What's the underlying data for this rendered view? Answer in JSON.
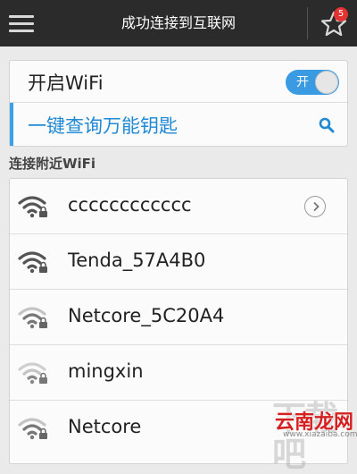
{
  "header": {
    "title": "成功连接到互联网",
    "menu_icon": "menu-icon",
    "favorites_icon": "star-icon",
    "favorites_badge": "5"
  },
  "wifi_toggle": {
    "label": "开启WiFi",
    "state_text": "开",
    "on": true
  },
  "query": {
    "label": "一键查询万能钥匙",
    "icon": "search-icon"
  },
  "nearby": {
    "section_title": "连接附近WiFi",
    "networks": [
      {
        "name": "cccccccccccc",
        "signal": "strong",
        "locked": true,
        "has_detail": true
      },
      {
        "name": "Tenda_57A4B0",
        "signal": "strong",
        "locked": true,
        "has_detail": false
      },
      {
        "name": "Netcore_5C20A4",
        "signal": "medium",
        "locked": true,
        "has_detail": false
      },
      {
        "name": "mingxin",
        "signal": "weak",
        "locked": true,
        "has_detail": false
      },
      {
        "name": "Netcore",
        "signal": "medium",
        "locked": true,
        "has_detail": false
      }
    ]
  },
  "watermark": {
    "text": "云南龙网",
    "background_text": "下载吧",
    "url": "www.xiazaiba.com"
  },
  "colors": {
    "header_bg": "#2b2b2b",
    "accent_blue": "#3b9be2",
    "badge_red": "#e23232"
  }
}
